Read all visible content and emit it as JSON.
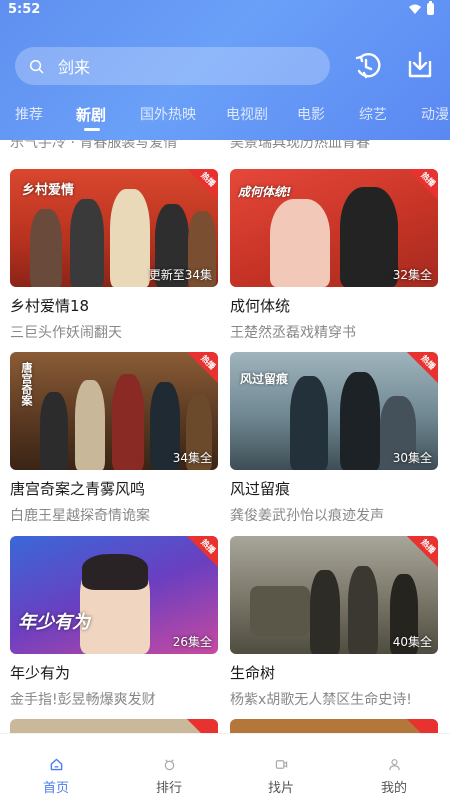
{
  "status": {
    "time": "5:52"
  },
  "search": {
    "query": "剑来"
  },
  "header": {
    "tabs": [
      {
        "label": "推荐"
      },
      {
        "label": "新剧"
      },
      {
        "label": "国外热映"
      },
      {
        "label": "电视剧"
      },
      {
        "label": "电影"
      },
      {
        "label": "综艺"
      },
      {
        "label": "动漫"
      }
    ],
    "active_tab": "新剧"
  },
  "partial_row": {
    "left": "乐气手冷 · 青春服装写爱情",
    "right": "吴景瑞具现历热血青春"
  },
  "cards": [
    {
      "title": "乡村爱情18",
      "subtitle": "三巨头作妖闹翻天",
      "episodes": "更新至34集",
      "badge": "热播",
      "poster_text": "乡村爱情"
    },
    {
      "title": "成何体统",
      "subtitle": "王楚然丞磊戏精穿书",
      "episodes": "32集全",
      "badge": "热播",
      "poster_text": "成何体统!"
    },
    {
      "title": "唐宫奇案之青雾风鸣",
      "subtitle": "白鹿王星越探奇情诡案",
      "episodes": "34集全",
      "badge": "热播",
      "poster_text": "唐宫奇案"
    },
    {
      "title": "风过留痕",
      "subtitle": "龚俊姜武孙怡以痕迹发声",
      "episodes": "30集全",
      "badge": "热播",
      "poster_text": "风过留痕"
    },
    {
      "title": "年少有为",
      "subtitle": "金手指!彭昱畅爆爽发财",
      "episodes": "26集全",
      "badge": "热播",
      "poster_text": "年少有为"
    },
    {
      "title": "生命树",
      "subtitle": "杨紫x胡歌无人禁区生命史诗!",
      "episodes": "40集全",
      "badge": "热播",
      "poster_text": ""
    }
  ],
  "bottom_nav": [
    {
      "label": "首页",
      "icon": "home-icon",
      "active": true
    },
    {
      "label": "排行",
      "icon": "ranking-icon",
      "active": false
    },
    {
      "label": "找片",
      "icon": "find-video-icon",
      "active": false
    },
    {
      "label": "我的",
      "icon": "profile-icon",
      "active": false
    }
  ],
  "colors": {
    "accent": "#4a7df0",
    "header_start": "#5f8ff0",
    "hot_badge": "#e8322f"
  }
}
